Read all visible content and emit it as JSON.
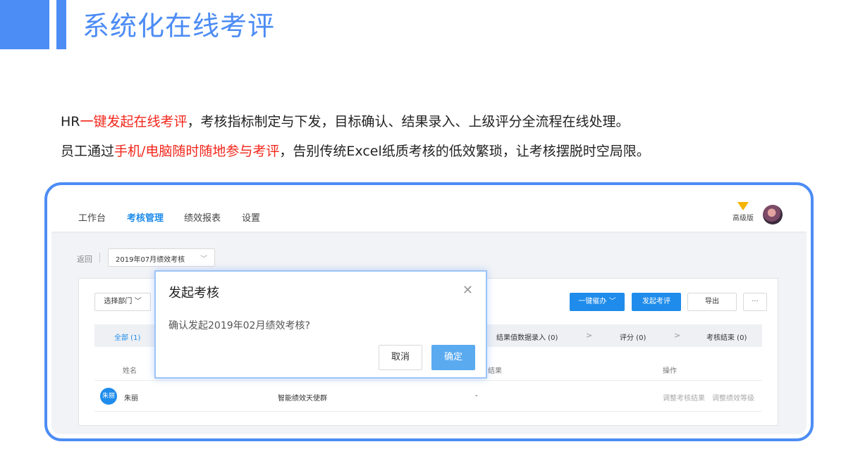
{
  "header": {
    "title": "系统化在线考评",
    "accent_color": "#4c8cf5"
  },
  "intro": {
    "line1": {
      "pre": "HR",
      "highlight": "一键发起在线考评",
      "post": "，考核指标制定与下发，目标确认、结果录入、上级评分全流程在线处理。"
    },
    "line2": {
      "pre": "员工通过",
      "highlight": "手机/电脑随时随地参与考评",
      "post": "，告别传统Excel纸质考核的低效繁琐，让考核摆脱时空局限。"
    },
    "highlight_color": "#f2261a"
  },
  "app": {
    "nav": {
      "items": [
        "工作台",
        "考核管理",
        "绩效报表",
        "设置"
      ],
      "active": "考核管理",
      "vip_label": "高级版"
    },
    "back_label": "返回",
    "period_select": "2019年07月绩效考核",
    "toolbar": {
      "dept_select": "选择部门",
      "urge_label": "一键催办",
      "launch_label": "发起考评",
      "export_label": "导出",
      "more_label": "···"
    },
    "steps": {
      "all": "全部 (1)",
      "result_entry": "结果值数据录入 (0)",
      "scoring": "评分 (0)",
      "finished": "考核结束 (0)"
    },
    "table": {
      "headers": {
        "name": "姓名",
        "result": "结果",
        "actions": "操作"
      },
      "rows": [
        {
          "avatar": "朱丽",
          "name": "朱丽",
          "group": "智能绩效天使群",
          "result": "-",
          "action1": "调整考核结果",
          "action2": "调整绩效等级"
        }
      ]
    },
    "modal": {
      "title": "发起考核",
      "message": "确认发起2019年02月绩效考核?",
      "cancel": "取消",
      "confirm": "确定"
    },
    "primary_color": "#1f8ceb"
  }
}
